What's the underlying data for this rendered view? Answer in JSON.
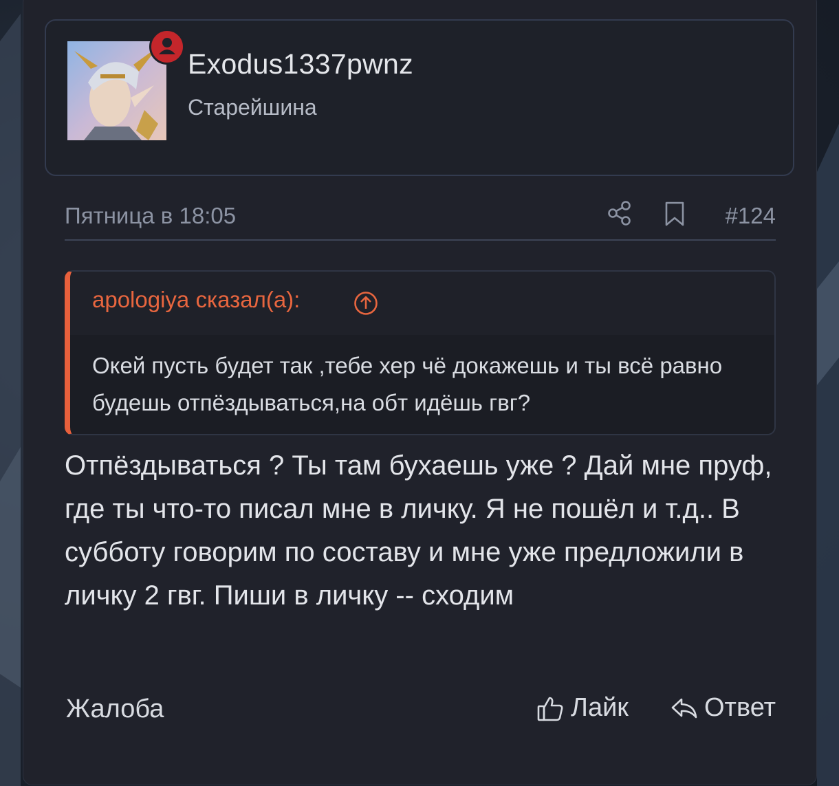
{
  "post": {
    "author": {
      "username": "Exodus1337pwnz",
      "title": "Старейшина",
      "avatar_icon": "elf-avatar",
      "status_icon": "user-status-icon",
      "status_color": "#c4262b"
    },
    "meta": {
      "date": "Пятница в 18:05",
      "share_icon": "share-icon",
      "bookmark_icon": "bookmark-icon",
      "number": "#124"
    },
    "quote": {
      "author": "apologiya сказал(а):",
      "jump_icon": "arrow-up-circle-icon",
      "text": "Окей пусть будет так ,тебе хер чё докажешь и ты всё равно будешь отпёздываться,на обт идёшь гвг?",
      "accent_color": "#e8603c"
    },
    "message": "Отпёздываться ? Ты там бухаешь уже ? Дай мне пруф, где ты что-то писал мне в личку. Я не пошёл и т.д.. В субботу говорим по составу и мне уже предложили в личку 2 гвг. Пиши в личку -- сходим",
    "actions": {
      "report": "Жалоба",
      "like": "Лайк",
      "like_icon": "thumbs-up-icon",
      "reply": "Ответ",
      "reply_icon": "reply-arrow-icon"
    }
  }
}
